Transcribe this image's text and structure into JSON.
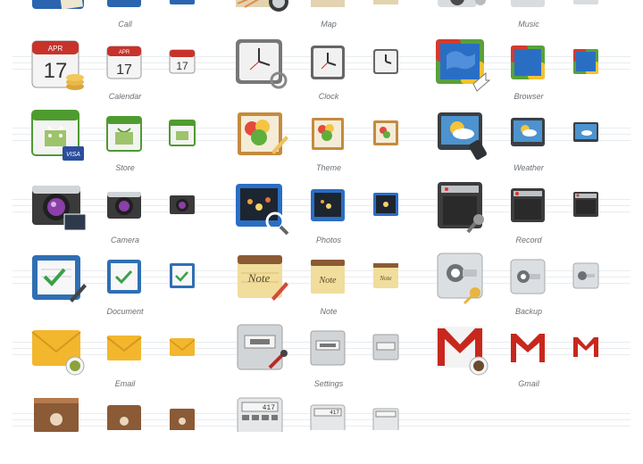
{
  "labels": {
    "call": "Call",
    "map": "Map",
    "music": "Music",
    "calendar": "Calendar",
    "clock": "Clock",
    "browser": "Browser",
    "store": "Store",
    "theme": "Theme",
    "weather": "Weather",
    "camera": "Camera",
    "photos": "Photos",
    "record": "Record",
    "document": "Document",
    "note": "Note",
    "backup": "Backup",
    "email": "Email",
    "settings": "Settings",
    "gmail": "Gmail"
  },
  "icon_text": {
    "calendar_month": "APR",
    "calendar_day": "17",
    "store_card": "VISA",
    "note_word": "Note",
    "calculator_display": "417"
  },
  "colors": {
    "background": "#ffffff",
    "label": "#6a6f75",
    "rule": "#e9ecef",
    "calendar_red": "#c7332b",
    "store_green": "#4e9b2f",
    "gmail_red": "#c8271d",
    "email_yellow": "#f2b72d",
    "document_blue": "#2f6fb3",
    "browser_blue": "#2a6ec4",
    "contacts_brown": "#8b5a36"
  }
}
